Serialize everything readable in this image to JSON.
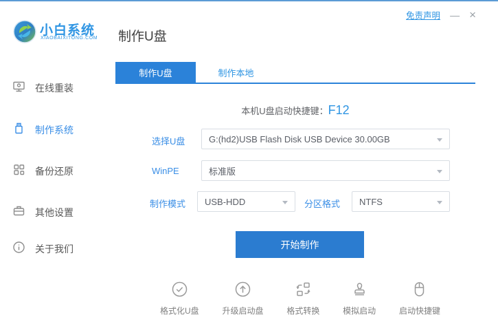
{
  "window_controls": {
    "disclaimer": "免责声明",
    "minimize": "—",
    "close": "×"
  },
  "brand": {
    "name": "小白系统",
    "domain": "XIAOBAIXITONG.COM"
  },
  "header": {
    "title": "制作U盘"
  },
  "sidebar": {
    "items": [
      {
        "label": "在线重装",
        "icon": "monitor-icon",
        "active": false
      },
      {
        "label": "制作系统",
        "icon": "usb-drive-icon",
        "active": true
      },
      {
        "label": "备份还原",
        "icon": "grid-icon",
        "active": false
      },
      {
        "label": "其他设置",
        "icon": "briefcase-icon",
        "active": false
      },
      {
        "label": "关于我们",
        "icon": "info-icon",
        "active": false
      }
    ]
  },
  "tabs": [
    {
      "label": "制作U盘",
      "active": true
    },
    {
      "label": "制作本地",
      "active": false
    }
  ],
  "hotkey": {
    "prefix": "本机U盘启动快捷键：",
    "key": "F12"
  },
  "form": {
    "usb": {
      "label": "选择U盘",
      "value": "G:(hd2)USB Flash Disk USB Device 30.00GB"
    },
    "winpe": {
      "label": "WinPE",
      "value": "标准版"
    },
    "mode": {
      "label": "制作模式",
      "value": "USB-HDD"
    },
    "partition": {
      "label": "分区格式",
      "value": "NTFS"
    }
  },
  "actions": {
    "start": "开始制作"
  },
  "tools": [
    {
      "label": "格式化U盘",
      "icon": "check-circle-icon"
    },
    {
      "label": "升级启动盘",
      "icon": "upload-circle-icon"
    },
    {
      "label": "格式转换",
      "icon": "convert-icon"
    },
    {
      "label": "模拟启动",
      "icon": "stamp-icon"
    },
    {
      "label": "启动快捷键",
      "icon": "mouse-icon"
    }
  ],
  "colors": {
    "accent_blue": "#2b82d9",
    "link_blue": "#2f95e3",
    "label_blue": "#3a8ee6",
    "button_blue": "#2b7cd0",
    "top_border": "#5b9bd5"
  }
}
